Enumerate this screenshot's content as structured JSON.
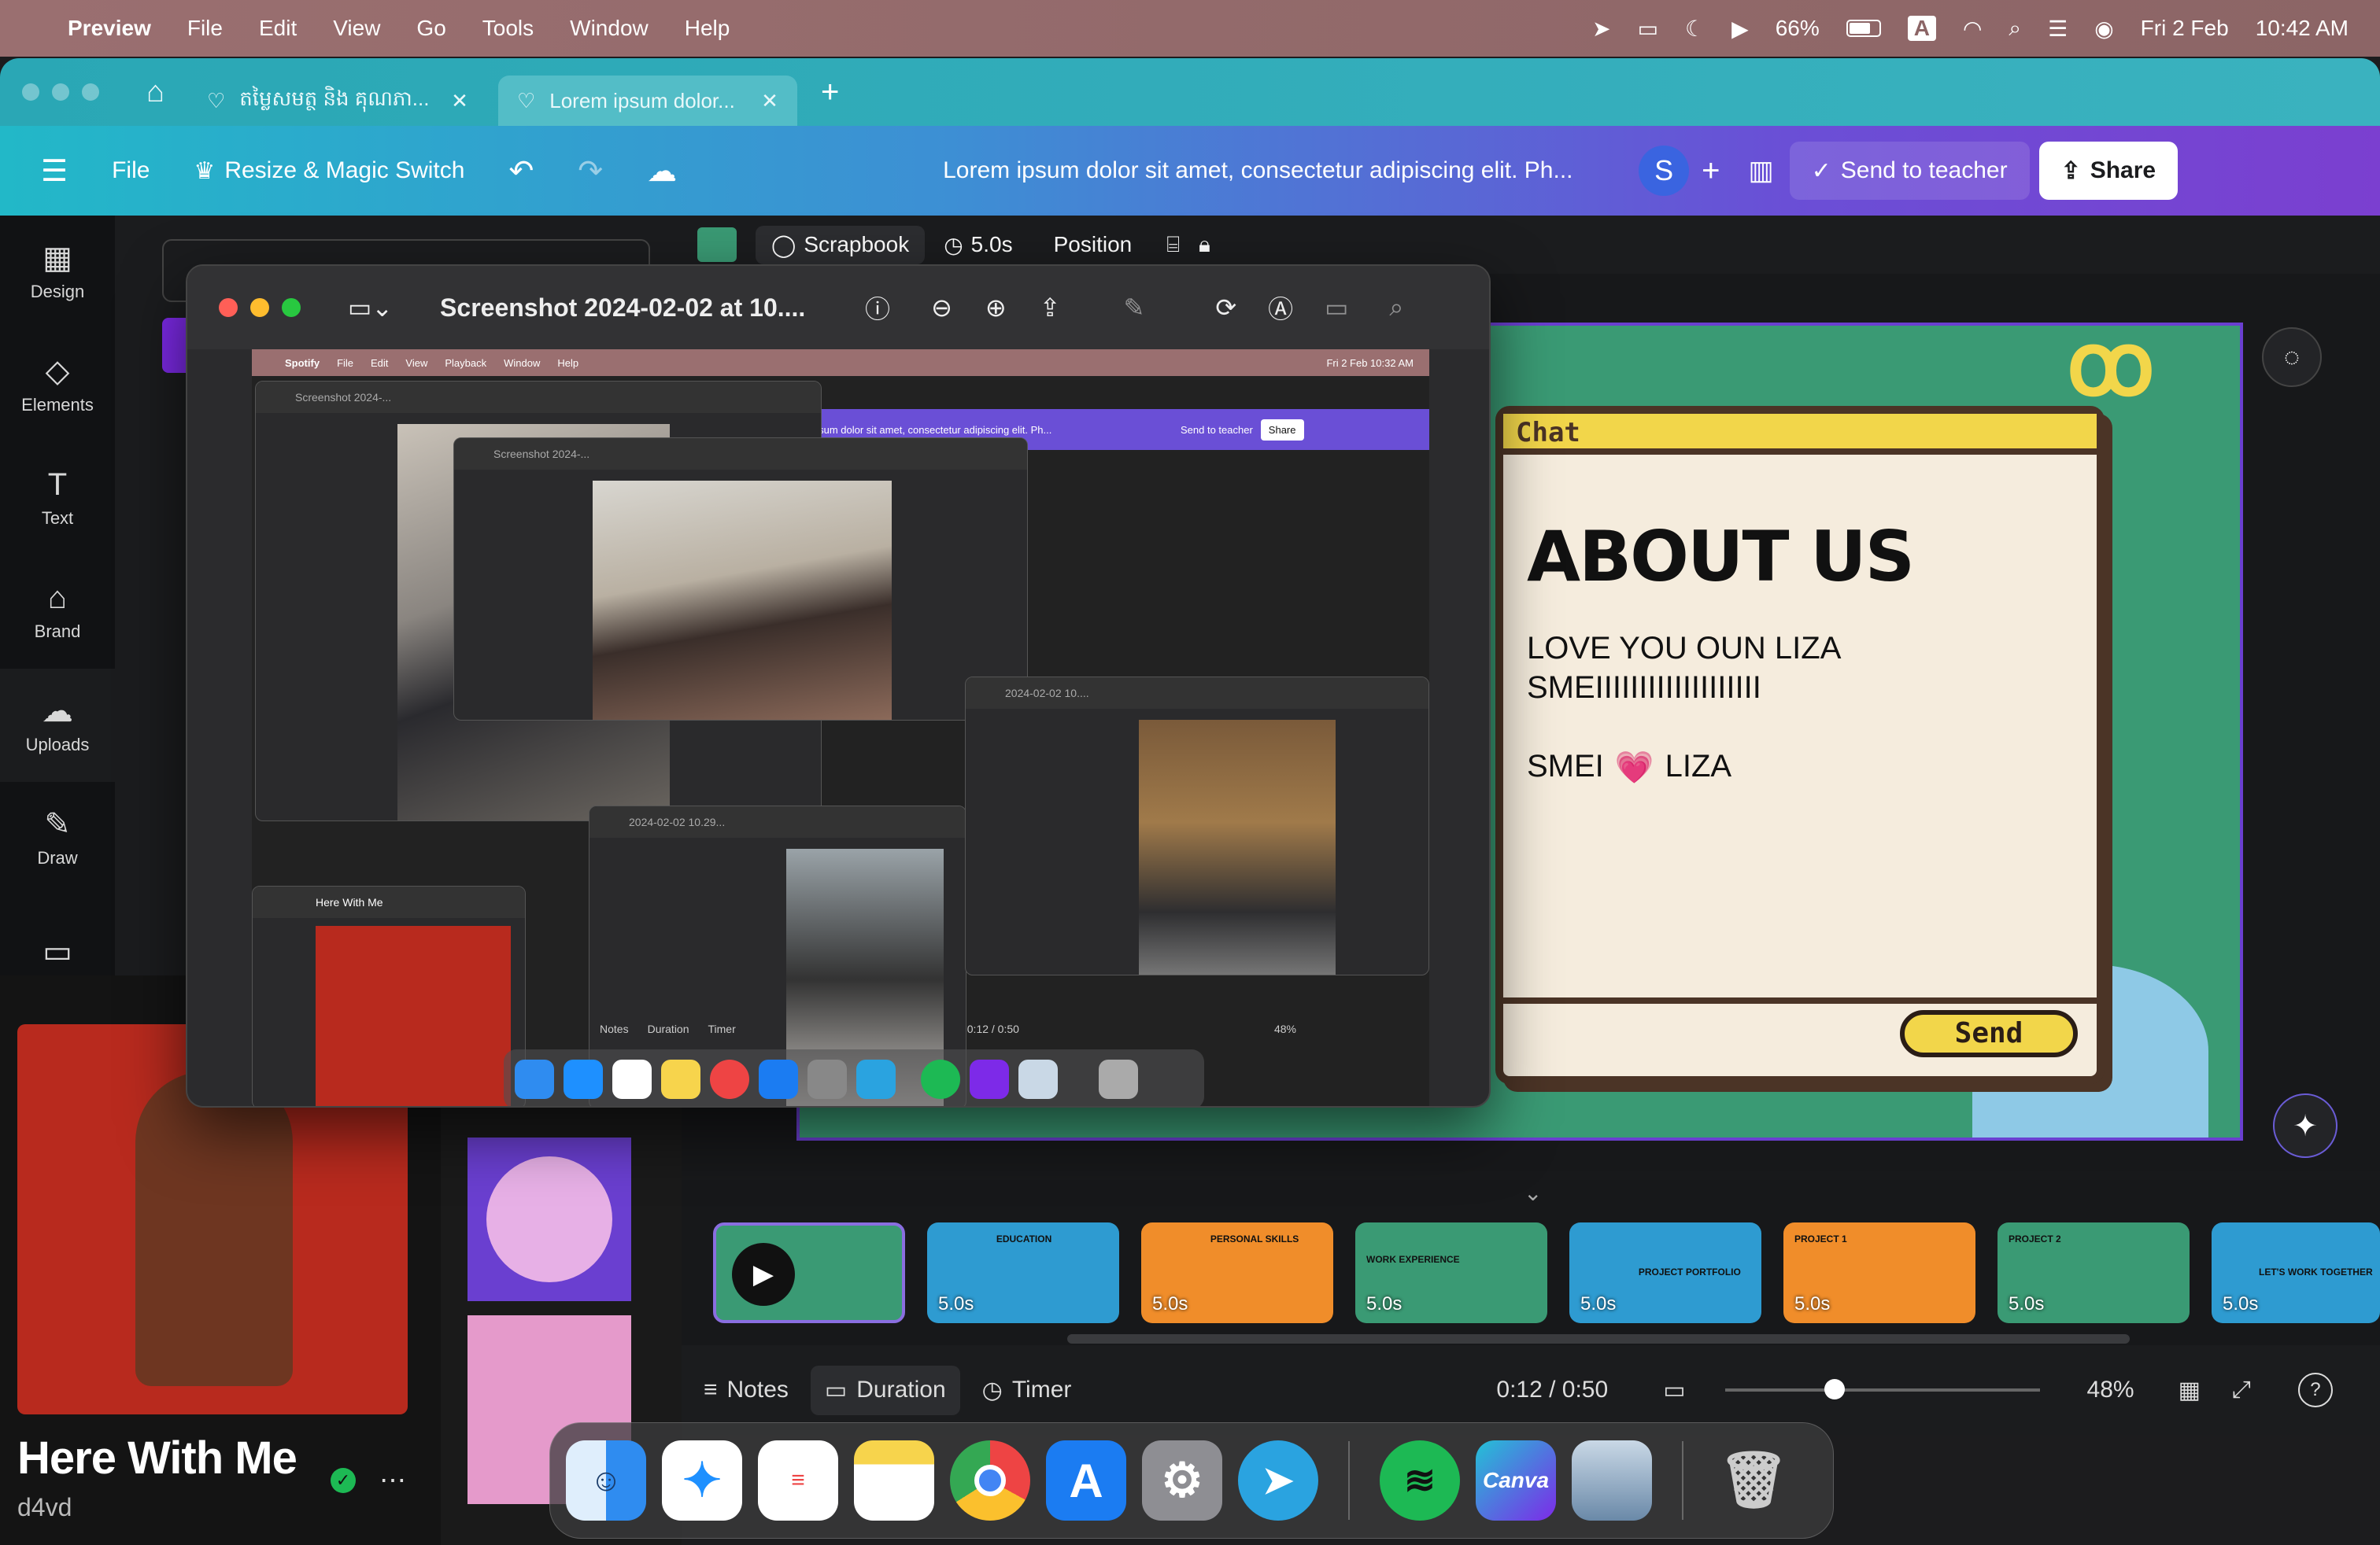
{
  "menubar": {
    "apple": "",
    "app": "Preview",
    "items": [
      "File",
      "Edit",
      "View",
      "Go",
      "Tools",
      "Window",
      "Help"
    ],
    "battery": "66%",
    "input": "A",
    "date": "Fri 2 Feb",
    "time": "10:42 AM"
  },
  "browser": {
    "tabs": [
      {
        "label": "តម្លៃសមត្ថ និង គុណភា..."
      },
      {
        "label": "Lorem ipsum dolor..."
      }
    ],
    "new_tab": "+"
  },
  "canva_toolbar": {
    "file": "File",
    "resize": "Resize & Magic Switch",
    "doc_title": "Lorem ipsum dolor sit amet, consectetur adipiscing elit. Ph...",
    "avatar": "S",
    "send_to_teacher": "Send to teacher",
    "share": "Share"
  },
  "sidebar": {
    "items": [
      {
        "label": "Design",
        "icon": "design-icon"
      },
      {
        "label": "Elements",
        "icon": "elements-icon"
      },
      {
        "label": "Text",
        "icon": "text-icon"
      },
      {
        "label": "Brand",
        "icon": "brand-icon"
      },
      {
        "label": "Uploads",
        "icon": "uploads-icon"
      },
      {
        "label": "Draw",
        "icon": "draw-icon"
      }
    ]
  },
  "editbar": {
    "font": "Scrapbook",
    "duration": "5.0s",
    "position": "Position"
  },
  "slide": {
    "chat_header": "Chat",
    "heading": "ABOUT US",
    "line1": "LOVE YOU OUN LIZA",
    "line2": "SMEIIIIIIIIIIIIIIIIIII",
    "line3a": "SMEI",
    "heart": "💗",
    "line3b": "LIZA",
    "send": "Send"
  },
  "timeline": {
    "thumbs": [
      {
        "dur": "5.0s",
        "title": "",
        "color": "#3a9a74"
      },
      {
        "dur": "5.0s",
        "title": "EDUCATION",
        "color": "#2e9bd1"
      },
      {
        "dur": "5.0s",
        "title": "PERSONAL SKILLS",
        "color": "#f08d2a"
      },
      {
        "dur": "5.0s",
        "title": "WORK EXPERIENCE",
        "color": "#3a9a74"
      },
      {
        "dur": "5.0s",
        "title": "PROJECT PORTFOLIO",
        "color": "#2e9bd1"
      },
      {
        "dur": "5.0s",
        "title": "PROJECT 1",
        "color": "#f08d2a"
      },
      {
        "dur": "5.0s",
        "title": "PROJECT 2",
        "color": "#3a9a74"
      },
      {
        "dur": "5.0s",
        "title": "LET'S WORK TOGETHER",
        "color": "#2e9bd1"
      }
    ]
  },
  "footer": {
    "notes": "Notes",
    "duration": "Duration",
    "timer": "Timer",
    "time": "0:12 / 0:50",
    "zoom": "48%",
    "progress": 0.24,
    "zoom_value": 0.48
  },
  "preview_window": {
    "title": "Screenshot 2024-02-02 at 10....",
    "mini_menu": [
      "Spotify",
      "File",
      "Edit",
      "View",
      "Playback",
      "Window",
      "Help"
    ],
    "mini_date": "Fri 2 Feb  10:32 AM",
    "mini_windows": [
      "Screenshot 2024-...",
      "Screenshot 2024-...",
      "2024-02-02 10.29...",
      "2024-02-02 10...."
    ],
    "mini_send": "Send to teacher",
    "mini_share": "Share",
    "mini_title": "ipsum dolor sit amet, consectetur adipiscing elit. Ph...",
    "mini_notes": "Notes",
    "mini_duration": "Duration",
    "mini_timer": "Timer",
    "mini_time": "0:12 / 0:50",
    "mini_zoom": "48%",
    "mini_here": "Here With Me"
  },
  "spotify": {
    "song": "Here With Me",
    "artist": "d4vd"
  },
  "dock": {
    "apps": [
      "Finder",
      "Safari",
      "Reminders",
      "Notes",
      "Chrome",
      "App Store",
      "System Settings",
      "Telegram",
      "Spotify",
      "Canva",
      "Preview",
      "Trash"
    ],
    "canva_label": "Canva"
  },
  "colors": {
    "menubar": "#9a6f70",
    "canva_gradient_start": "#22b8c8",
    "canva_gradient_end": "#7b3fd0",
    "slide_green": "#3a9a74",
    "chat_yellow": "#f2d64a",
    "spotify_green": "#1db954"
  }
}
